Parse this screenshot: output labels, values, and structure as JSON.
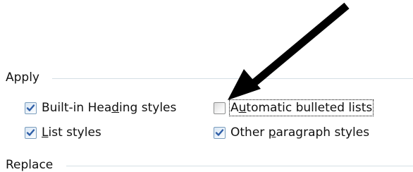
{
  "groups": {
    "apply": {
      "label": "Apply"
    },
    "replace": {
      "label": "Replace"
    }
  },
  "options": {
    "builtin_heading": {
      "pre": "Built-in Hea",
      "mn": "d",
      "post": "ing styles",
      "checked": true
    },
    "automatic_bulleted": {
      "pre": "A",
      "mn": "u",
      "post": "tomatic bulleted lists",
      "checked": false,
      "focused": true
    },
    "list_styles": {
      "pre": "",
      "mn": "L",
      "post": "ist styles",
      "checked": true
    },
    "other_paragraph": {
      "pre": "Other ",
      "mn": "p",
      "post": "aragraph styles",
      "checked": true
    }
  },
  "icons": {
    "check": "checkmark-icon",
    "annotation": "arrow-annotation-icon"
  },
  "colors": {
    "check_blue": "#2f5fa8",
    "group_line": "#d5dfe5",
    "arrow": "#000000"
  }
}
